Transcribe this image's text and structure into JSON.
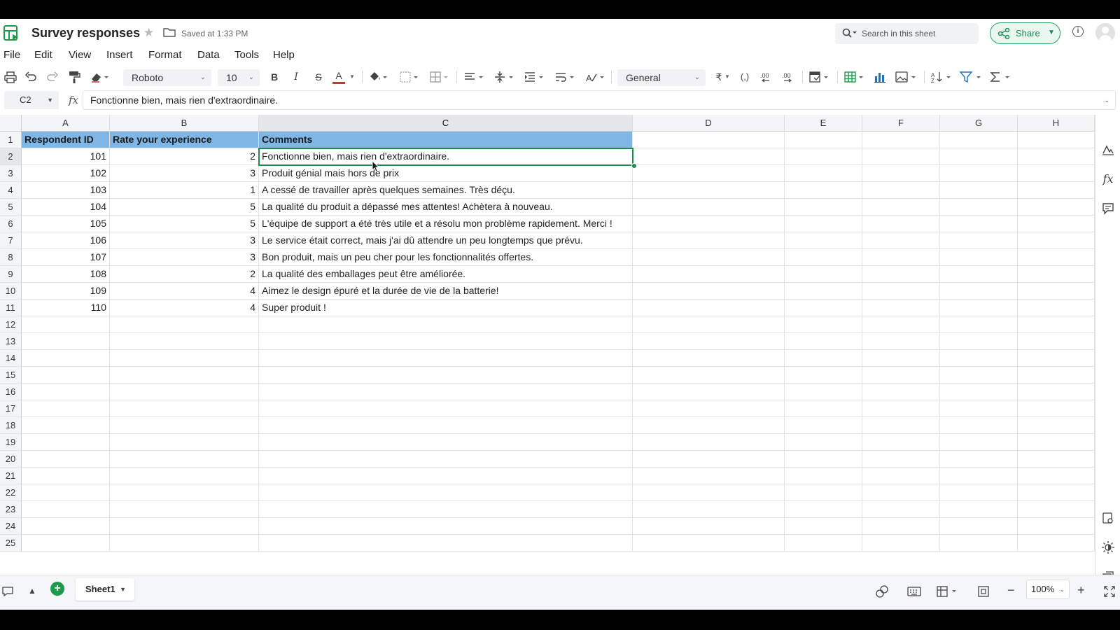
{
  "title": "Survey responses",
  "saved_status": "Saved at 1:33 PM",
  "search": {
    "placeholder": "Search in this sheet"
  },
  "share_label": "Share",
  "menu": [
    "File",
    "Edit",
    "View",
    "Insert",
    "Format",
    "Data",
    "Tools",
    "Help"
  ],
  "toolbar": {
    "font_family": "Roboto",
    "font_size": "10",
    "number_format": "General",
    "bold": "B",
    "italic": "I",
    "strike": "S",
    "text_color": "A",
    "currency": "₹"
  },
  "formula_bar": {
    "cell_ref": "C2",
    "fx": "fx",
    "content": "Fonctionne bien, mais rien d'extraordinaire."
  },
  "columns": [
    "A",
    "B",
    "C",
    "D",
    "E",
    "F",
    "G",
    "H"
  ],
  "rows": [
    "1",
    "2",
    "3",
    "4",
    "5",
    "6",
    "7",
    "8",
    "9",
    "10",
    "11",
    "12",
    "13",
    "14",
    "15",
    "16",
    "17",
    "18",
    "19",
    "20",
    "21",
    "22",
    "23",
    "24",
    "25"
  ],
  "table": {
    "headers": [
      "Respondent ID",
      "Rate your experience",
      "Comments"
    ],
    "rows": [
      [
        "101",
        "2",
        "Fonctionne bien, mais rien d'extraordinaire."
      ],
      [
        "102",
        "3",
        "Produit génial mais hors de prix"
      ],
      [
        "103",
        "1",
        "A cessé de travailler après quelques semaines. Très déçu."
      ],
      [
        "104",
        "5",
        "La qualité du produit a dépassé mes attentes! Achètera à nouveau."
      ],
      [
        "105",
        "5",
        "L'équipe de support a été très utile et a résolu mon problème rapidement. Merci !"
      ],
      [
        "106",
        "3",
        "Le service était correct, mais j'ai dû attendre un peu longtemps que prévu."
      ],
      [
        "107",
        "3",
        "Bon produit, mais un peu cher pour les fonctionnalités offertes."
      ],
      [
        "108",
        "2",
        "La qualité des emballages peut être améliorée."
      ],
      [
        "109",
        "4",
        "Aimez le design épuré et la durée de vie de la batterie!"
      ],
      [
        "110",
        "4",
        "Super produit !"
      ]
    ]
  },
  "selected_cell": "C2",
  "sheet_tab": "Sheet1",
  "zoom": "100%",
  "colors": {
    "header_fill": "#7fb6e5",
    "selection": "#1e8a4c",
    "share_accent": "#29a36a"
  }
}
